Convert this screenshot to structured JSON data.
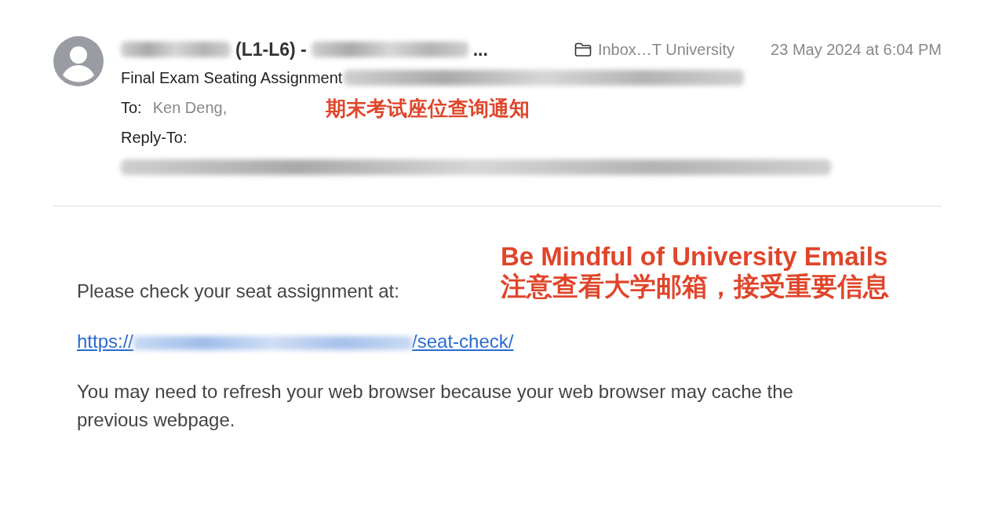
{
  "header": {
    "sender": [
      {
        "kind": "blur"
      },
      {
        "kind": "text",
        "text": "(L1-L6) -"
      },
      {
        "kind": "blur"
      },
      {
        "kind": "text",
        "text": "..."
      }
    ],
    "mailbox": "Inbox…T University",
    "date": "23 May 2024 at 6:04 PM",
    "subject": {
      "text": "Final Exam Seating Assignment",
      "blurred": true
    },
    "to": {
      "label": "To:",
      "value": "Ken Deng,"
    },
    "reply_to": {
      "label": "Reply-To:",
      "blurred": true
    }
  },
  "annotations": [
    {
      "kind": "header",
      "lines": [
        "期末考试座位查询通知"
      ]
    },
    {
      "kind": "body",
      "lines": [
        "Be Mindful of University Emails",
        "注意查看大学邮箱，接受重要信息"
      ]
    }
  ],
  "body": {
    "intro": "Please check your seat assignment at:",
    "link": {
      "prefix": "https://",
      "suffix": "/seat-check/"
    },
    "note": "You may need to refresh your web browser because your web browser may cache the previous webpage."
  }
}
